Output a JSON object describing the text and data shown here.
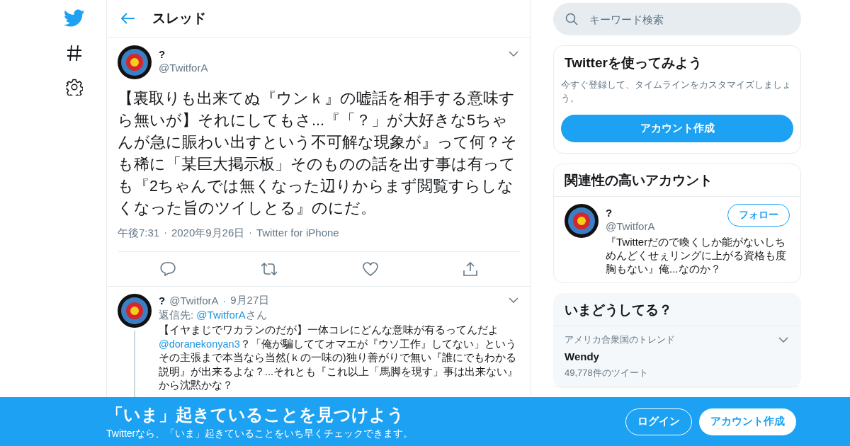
{
  "nav": [
    {
      "kind": "logo"
    },
    {
      "kind": "explore"
    },
    {
      "kind": "settings"
    }
  ],
  "header": {
    "title": "スレッド"
  },
  "main_tweet": {
    "name": "?",
    "handle": "@TwitforA",
    "separators": [
      "·",
      "·"
    ],
    "text": "【裏取りも出来てぬ『ウンｋ』の嘘話を相手する意味すら無いが】それにしてもさ...『「？」が大好きな5ちゃんが急に賑わい出すという不可解な現象が』って何？そも稀に「某巨大掲示板」そのものの話を出す事は有っても『2ちゃんでは無くなった辺りからまず閲覧すらしなくなった旨のツイしとる』のにだ。",
    "time": "午後7:31",
    "date": "2020年9月26日",
    "source": "Twitter for iPhone",
    "actions": [
      {
        "kind": "reply"
      },
      {
        "kind": "retweet"
      },
      {
        "kind": "like"
      },
      {
        "kind": "share"
      }
    ]
  },
  "reply_tweet": {
    "name": "?",
    "handle": "@TwitforA",
    "separator": "·",
    "date": "9月27日",
    "reply_to_label": "返信先:",
    "reply_to": "@TwitforA",
    "reply_to_suffix": "さん",
    "text": [
      {
        "kind": "text",
        "text": "【イヤまじでワカランのだが】一体コレにどんな意味が有るってんだよ"
      },
      {
        "kind": "mention",
        "text": "@doranekonyan3"
      },
      {
        "kind": "text",
        "text": "？「俺が騙しててオマエが『ウソ工作』してない」というその主張まで本当なら当然(ｋの一味の)独り善がりで無い『誰にでもわかる説明』が出来るよな？...それとも『これ以上「馬脚を現す」事は出来ない』から沈黙かな？"
      }
    ]
  },
  "search": {
    "placeholder": "キーワード検索"
  },
  "signup_card": {
    "title": "Twitterを使ってみよう",
    "text": "今すぐ登録して、タイムラインをカスタマイズしましょう。",
    "button": "アカウント作成"
  },
  "related_card": {
    "title": "関連性の高いアカウント",
    "accounts": [
      {
        "name": "?",
        "handle": "@TwitforA",
        "button": "フォロー",
        "bio": "『Twitterだので喚くしか能がないしちめんどくせぇリングに上がる資格も度胸もない』俺...なのか？"
      }
    ]
  },
  "trends_card": {
    "title": "いまどうしてる？",
    "trends": [
      {
        "context": "アメリカ合衆国のトレンド",
        "name": "Wendy",
        "count": "49,778件のツイート"
      }
    ]
  },
  "banner": {
    "title": "「いま」起きていることを見つけよう",
    "subtitle": "Twitterなら、「いま」起きていることをいち早くチェックできます。",
    "buttons": [
      {
        "kind": "outline",
        "label": "ログイン"
      },
      {
        "kind": "filled",
        "label": "アカウント作成"
      }
    ]
  }
}
